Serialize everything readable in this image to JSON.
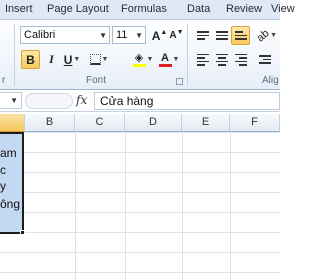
{
  "ribbon_tabs": [
    "Insert",
    "Page Layout",
    "Formulas",
    "Data",
    "Review",
    "View"
  ],
  "font": {
    "name": "Calibri",
    "size": "11",
    "group_label": "Font",
    "grow_label": "A",
    "shrink_label": "A",
    "bold_label": "B",
    "italic_label": "I",
    "underline_label": "U",
    "font_color_label": "A",
    "fill_color": "#ffff00",
    "font_color": "#e02020"
  },
  "clipboard": {
    "group_label_fragment": "r"
  },
  "alignment": {
    "group_label": "Alig"
  },
  "formula_bar": {
    "fx_label": "fx",
    "value": "Cửa hàng"
  },
  "columns": [
    "B",
    "C",
    "D",
    "E",
    "F"
  ],
  "cells": [
    "am",
    "c",
    "y",
    "ông"
  ],
  "colors": {
    "selection_fill": "#c3d9f3",
    "active_button": "#f7c95a"
  }
}
